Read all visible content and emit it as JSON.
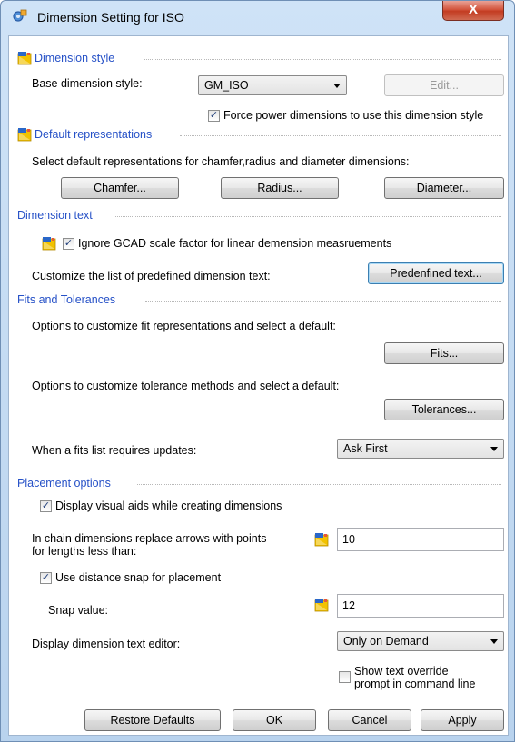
{
  "window": {
    "title": "Dimension Setting for ISO",
    "close_label": "X"
  },
  "dimension_style": {
    "heading": "Dimension style",
    "base_label": "Base dimension style:",
    "base_value": "GM_ISO",
    "edit_label": "Edit...",
    "force_label": "Force power dimensions to use this dimension style",
    "force_checked": true
  },
  "default_representations": {
    "heading": "Default representations",
    "description": "Select default representations for chamfer,radius and diameter dimensions:",
    "chamfer_label": "Chamfer...",
    "radius_label": "Radius...",
    "diameter_label": "Diameter..."
  },
  "dimension_text": {
    "heading": "Dimension text",
    "ignore_label": "Ignore GCAD scale factor for linear demension measruements",
    "ignore_checked": true,
    "customize_label": "Customize the list of predefined dimension text:",
    "predefined_label": "Predenfined text..."
  },
  "fits_tolerances": {
    "heading": "Fits and Tolerances",
    "fits_desc": "Options to customize fit representations and select a default:",
    "fits_label": "Fits...",
    "tol_desc": "Options to customize tolerance methods and select a default:",
    "tol_label": "Tolerances...",
    "update_label": "When a fits list requires updates:",
    "update_value": "Ask First"
  },
  "placement": {
    "heading": "Placement options",
    "visual_aids_label": "Display visual aids while creating dimensions",
    "visual_aids_checked": true,
    "chain_label_1": "In chain dimensions replace arrows with points",
    "chain_label_2": "for lengths less than:",
    "chain_value": "10",
    "snap_check_label": "Use distance snap for placement",
    "snap_checked": true,
    "snap_value_label": "Snap value:",
    "snap_value": "12",
    "editor_label": "Display dimension text editor:",
    "editor_value": "Only on Demand",
    "override_label_1": "Show text override",
    "override_label_2": "prompt in command line",
    "override_checked": false
  },
  "footer": {
    "restore_label": "Restore Defaults",
    "ok_label": "OK",
    "cancel_label": "Cancel",
    "apply_label": "Apply"
  },
  "colors": {
    "section_heading": "#2651c7",
    "icon_yellow": "#f2c200",
    "icon_blue": "#2a67c9"
  },
  "icons": {
    "app": "gear-app-icon",
    "setting": "gcad-setting-icon"
  }
}
